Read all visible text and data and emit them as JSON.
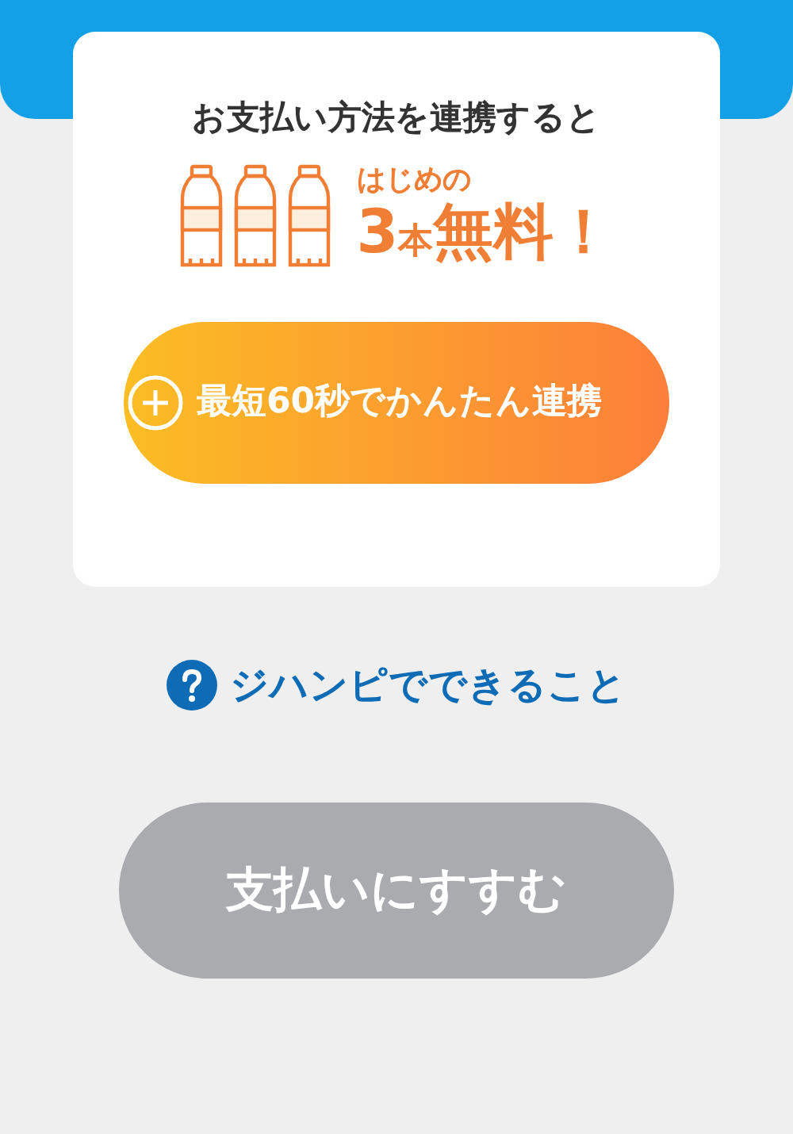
{
  "card": {
    "title": "お支払い方法を連携すると",
    "offer": {
      "lead": "はじめの",
      "count": "3",
      "unit": "本",
      "free": "無料！"
    },
    "link_button": {
      "label": "最短60秒でかんたん連携"
    }
  },
  "help_link": {
    "label": "ジハンピでできること"
  },
  "submit_button": {
    "label": "支払いにすすむ",
    "disabled": true
  }
}
